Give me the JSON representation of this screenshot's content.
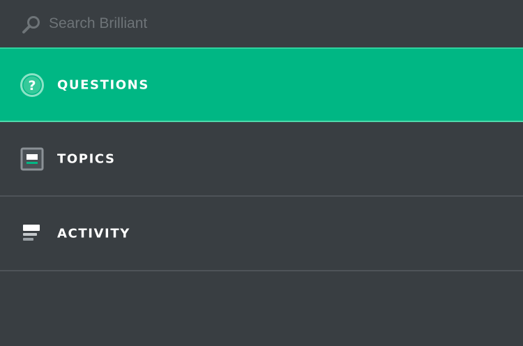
{
  "search": {
    "placeholder": "Search Brilliant",
    "icon": "search-icon"
  },
  "nav": {
    "items": [
      {
        "label": "QUESTIONS",
        "icon": "question-circle-icon",
        "active": true
      },
      {
        "label": "TOPICS",
        "icon": "topics-icon",
        "active": false
      },
      {
        "label": "ACTIVITY",
        "icon": "activity-icon",
        "active": false
      }
    ]
  },
  "colors": {
    "background": "#393e42",
    "accent": "#00b784",
    "divider": "#4e5358",
    "text": "#ffffff",
    "placeholder": "#6e7478"
  }
}
